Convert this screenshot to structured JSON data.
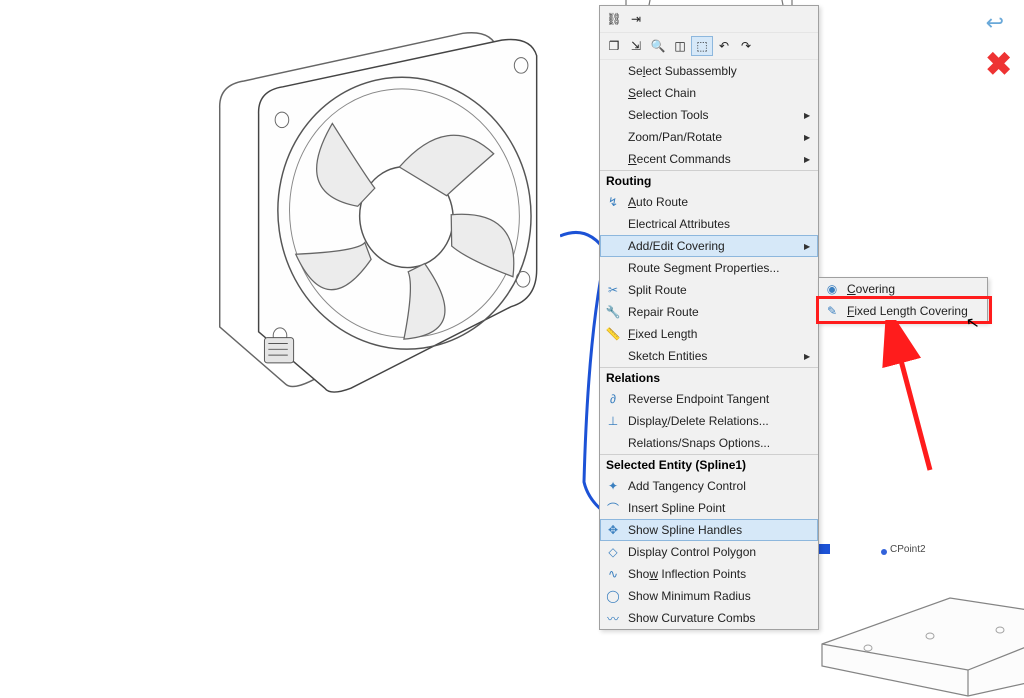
{
  "close_x": "✖",
  "undo_glyph": "↩",
  "context_menu": {
    "toolbar_row1": [
      {
        "name": "undo-link-icon",
        "glyph": "⛓"
      },
      {
        "name": "dimension-icon",
        "glyph": "⇥"
      }
    ],
    "toolbar_row2": [
      {
        "name": "copy-icon",
        "glyph": "❐"
      },
      {
        "name": "measure-icon",
        "glyph": "⇲"
      },
      {
        "name": "zoom-icon",
        "glyph": "🔍"
      },
      {
        "name": "view-icon",
        "glyph": "◫"
      },
      {
        "name": "normal-icon",
        "glyph": "⬚",
        "pressed": true
      },
      {
        "name": "rotate-left-icon",
        "glyph": "↶"
      },
      {
        "name": "rotate-right-icon",
        "glyph": "↷"
      }
    ],
    "top_items": [
      {
        "name": "select-subassembly",
        "label_pre": "Se",
        "hot": "l",
        "label_post": "ect Subassembly"
      },
      {
        "name": "select-chain",
        "hot": "S",
        "label_post": "elect Chain"
      },
      {
        "name": "selection-tools",
        "label": "Selection Tools",
        "submenu": true
      },
      {
        "name": "zoom-pan-rotate",
        "label": "Zoom/Pan/Rotate",
        "submenu": true
      },
      {
        "name": "recent-commands",
        "hot": "R",
        "label_post": "ecent Commands",
        "submenu": true
      }
    ],
    "sections": [
      {
        "title": "Routing",
        "items": [
          {
            "name": "auto-route",
            "hot": "A",
            "label_post": "uto Route",
            "icon": "route-icon"
          },
          {
            "name": "electrical-attrs",
            "label": "Electrical Attributes"
          },
          {
            "name": "add-edit-covering",
            "label": "Add/Edit Covering",
            "submenu": true,
            "selected": true
          },
          {
            "name": "route-seg-props",
            "label": "Route Segment Properties..."
          },
          {
            "name": "split-route",
            "label": "Split Route",
            "icon": "scissors-icon"
          },
          {
            "name": "repair-route",
            "label": "Repair Route",
            "icon": "wrench-icon"
          },
          {
            "name": "fixed-length",
            "hot": "F",
            "label_post": "ixed Length",
            "icon": "ruler-icon"
          },
          {
            "name": "sketch-entities",
            "label": "Sketch Entities",
            "submenu": true
          }
        ]
      },
      {
        "title": "Relations",
        "items": [
          {
            "name": "reverse-endpoint",
            "label": "Reverse Endpoint Tangent",
            "icon": "tangent-icon"
          },
          {
            "name": "display-relations",
            "label_pre": "Displa",
            "hot": "y",
            "label_post": "/Delete Relations...",
            "icon": "relations-icon"
          },
          {
            "name": "relations-snaps",
            "label": "Relations/Snaps Options..."
          }
        ]
      },
      {
        "title": "Selected Entity (Spline1)",
        "items": [
          {
            "name": "add-tangency",
            "label": "Add Tangency Control",
            "icon": "tangency-ctrl-icon"
          },
          {
            "name": "insert-spline-pt",
            "label": "Insert Spline Point",
            "icon": "spline-pt-icon"
          },
          {
            "name": "show-spline-handle",
            "label": "Show Spline Handles",
            "icon": "spline-handle-icon",
            "selected": true
          },
          {
            "name": "display-ctrl-poly",
            "label": "Display Control Polygon",
            "icon": "ctrl-poly-icon"
          },
          {
            "name": "show-inflection",
            "label_pre": "Sho",
            "hot": "w",
            "label_post": " Inflection Points",
            "icon": "inflection-icon"
          },
          {
            "name": "show-min-radius",
            "label": "Show Minimum Radius",
            "icon": "radius-icon"
          },
          {
            "name": "show-curvature",
            "label": "Show Curvature Combs",
            "icon": "curvature-icon"
          }
        ]
      }
    ],
    "submenu": {
      "items": [
        {
          "name": "covering",
          "hot": "C",
          "label_post": "overing",
          "icon": "covering-icon"
        },
        {
          "name": "fixed-length-cov",
          "hot": "F",
          "label_post": "ixed Length Covering",
          "icon": "fixed-cov-icon"
        }
      ]
    }
  }
}
